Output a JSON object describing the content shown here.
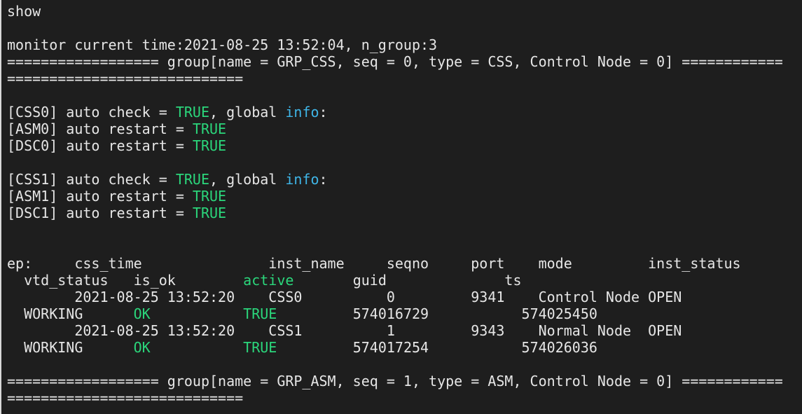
{
  "colors": {
    "background": "#1e1e1e",
    "text": "#e6e6e6",
    "green": "#2bd67b",
    "blue": "#3fb6e8"
  },
  "lines": [
    [
      {
        "t": "show",
        "c": "white"
      }
    ],
    [],
    [
      {
        "t": "monitor current time:2021-08-25 13:52:04, n_group:3",
        "c": "white"
      }
    ],
    [
      {
        "t": "================== group[name = GRP_CSS, seq = 0, type = CSS, Control Node = 0] ============",
        "c": "white"
      }
    ],
    [
      {
        "t": "============================",
        "c": "white"
      }
    ],
    [],
    [
      {
        "t": "[CSS0] auto check = ",
        "c": "white"
      },
      {
        "t": "TRUE",
        "c": "green"
      },
      {
        "t": ", global ",
        "c": "white"
      },
      {
        "t": "info",
        "c": "blue"
      },
      {
        "t": ":",
        "c": "white"
      }
    ],
    [
      {
        "t": "[ASM0] auto restart = ",
        "c": "white"
      },
      {
        "t": "TRUE",
        "c": "green"
      }
    ],
    [
      {
        "t": "[DSC0] auto restart = ",
        "c": "white"
      },
      {
        "t": "TRUE",
        "c": "green"
      }
    ],
    [],
    [
      {
        "t": "[CSS1] auto check = ",
        "c": "white"
      },
      {
        "t": "TRUE",
        "c": "green"
      },
      {
        "t": ", global ",
        "c": "white"
      },
      {
        "t": "info",
        "c": "blue"
      },
      {
        "t": ":",
        "c": "white"
      }
    ],
    [
      {
        "t": "[ASM1] auto restart = ",
        "c": "white"
      },
      {
        "t": "TRUE",
        "c": "green"
      }
    ],
    [
      {
        "t": "[DSC1] auto restart = ",
        "c": "white"
      },
      {
        "t": "TRUE",
        "c": "green"
      }
    ],
    [],
    [],
    [
      {
        "t": "ep:     css_time               inst_name     seqno     port    mode         inst_status",
        "c": "white"
      }
    ],
    [
      {
        "t": "  vtd_status   is_ok        ",
        "c": "white"
      },
      {
        "t": "active",
        "c": "green"
      },
      {
        "t": "       guid              ts",
        "c": "white"
      }
    ],
    [
      {
        "t": "        2021-08-25 13:52:20    CSS0          0         9341    Control Node OPEN",
        "c": "white"
      }
    ],
    [
      {
        "t": "  WORKING      ",
        "c": "white"
      },
      {
        "t": "OK",
        "c": "green"
      },
      {
        "t": "           ",
        "c": "white"
      },
      {
        "t": "TRUE",
        "c": "green"
      },
      {
        "t": "         574016729           574025450",
        "c": "white"
      }
    ],
    [
      {
        "t": "        2021-08-25 13:52:20    CSS1          1         9343    Normal Node  OPEN",
        "c": "white"
      }
    ],
    [
      {
        "t": "  WORKING      ",
        "c": "white"
      },
      {
        "t": "OK",
        "c": "green"
      },
      {
        "t": "           ",
        "c": "white"
      },
      {
        "t": "TRUE",
        "c": "green"
      },
      {
        "t": "         574017254           574026036",
        "c": "white"
      }
    ],
    [],
    [
      {
        "t": "================== group[name = GRP_ASM, seq = 1, type = ASM, Control Node = 0] ============",
        "c": "white"
      }
    ],
    [
      {
        "t": "============================",
        "c": "white"
      }
    ]
  ]
}
